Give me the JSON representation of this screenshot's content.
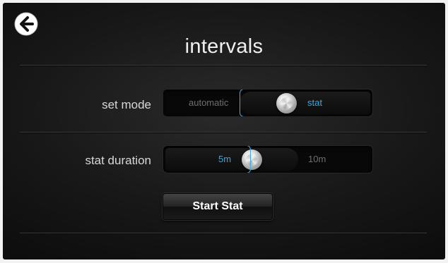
{
  "header": {
    "back_icon": "arrow-left-circle-icon",
    "title": "intervals"
  },
  "set_mode": {
    "label": "set mode",
    "options": [
      "automatic",
      "stat"
    ],
    "selected": "stat"
  },
  "stat_duration": {
    "label": "stat duration",
    "options": [
      "5m",
      "10m"
    ],
    "selected": "5m"
  },
  "actions": {
    "start_label": "Start Stat"
  },
  "colors": {
    "accent": "#3ea6dd",
    "text": "#e6e6e6",
    "muted": "#6f6f6f",
    "background": "#181818"
  }
}
